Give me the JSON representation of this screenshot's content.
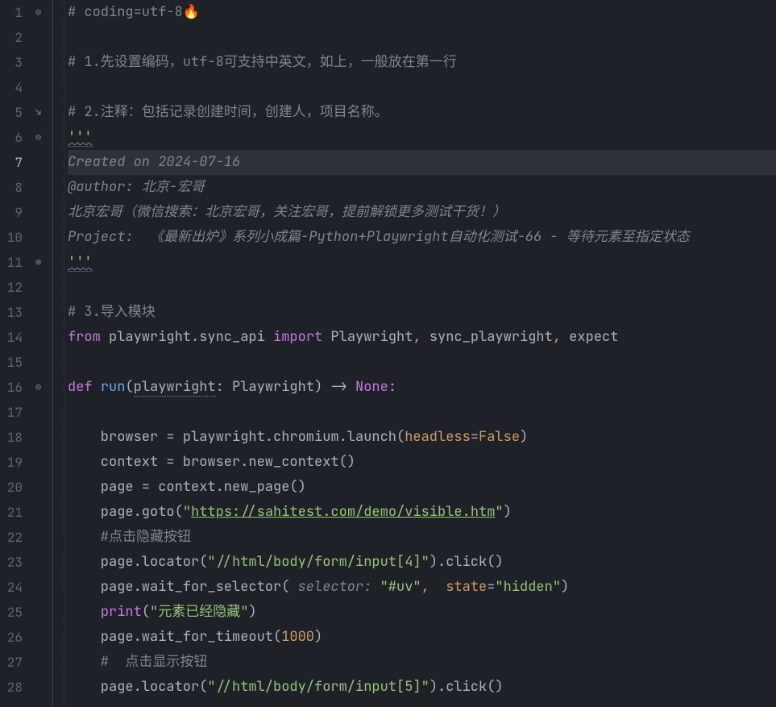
{
  "lines": {
    "count": 28,
    "current": 7
  },
  "fold_markers": [
    {
      "line": 1,
      "char": "⊖"
    },
    {
      "line": 5,
      "char": "↘"
    },
    {
      "line": 6,
      "char": "⊖"
    },
    {
      "line": 11,
      "char": "⊕"
    },
    {
      "line": 16,
      "char": "⊖"
    }
  ],
  "code": {
    "l1_a": "# coding=utf-8",
    "l1_fire": "🔥",
    "l3": "# 1.先设置编码，utf-8可支持中英文，如上，一般放在第一行",
    "l5": "# 2.注释：包括记录创建时间，创建人，项目名称。",
    "l6": "'''",
    "l7": "Created on 2024-07-16",
    "l8": "@author: 北京-宏哥",
    "l9": "北京宏哥（微信搜索：北京宏哥，关注宏哥，提前解锁更多测试干货！）",
    "l10": "Project:  《最新出炉》系列小成篇-Python+Playwright自动化测试-66 - 等待元素至指定状态",
    "l11": "'''",
    "l13": "# 3.导入模块",
    "l14_from": "from",
    "l14_mod": " playwright.sync_api ",
    "l14_import": "import",
    "l14_names": " Playwright, sync_playwright, expect",
    "l14_comma1": ",",
    "l14_comma2": ",",
    "l14_sp": " ",
    "l14_n1": " Playwright",
    "l14_n2": " sync_playwright",
    "l14_n3": " expect",
    "l16_def": "def ",
    "l16_fn": "run",
    "l16_p1": "(",
    "l16_param": "playwright",
    "l16_colon": ": ",
    "l16_type": "Playwright",
    "l16_p2": ") -> ",
    "l16_none": "None",
    "l16_end": ":",
    "l18_a": "    browser = playwright.chromium.launch(",
    "l18_hl": "headless",
    "l18_eq": "=",
    "l18_false": "False",
    "l18_p": ")",
    "l19": "    context = browser.new_context()",
    "l20": "    page = context.new_page()",
    "l21_a": "    page.goto(",
    "l21_q1": "\"",
    "l21_url": "https://sahitest.com/demo/visible.htm",
    "l21_q2": "\"",
    "l21_p": ")",
    "l22": "    #点击隐藏按钮",
    "l23_a": "    page.locator(",
    "l23_str": "\"//html/body/form/input[4]\"",
    "l23_b": ").click()",
    "l24_a": "    page.wait_for_selector(",
    "l24_hint": " selector: ",
    "l24_sel": "\"#uv\"",
    "l24_c": ",  ",
    "l24_state": "state",
    "l24_eq": "=",
    "l24_val": "\"hidden\"",
    "l24_p": ")",
    "l25_a": "    ",
    "l25_print": "print",
    "l25_p1": "(",
    "l25_str": "\"元素已经隐藏\"",
    "l25_p2": ")",
    "l26_a": "    page.wait_for_timeout(",
    "l26_num": "1000",
    "l26_p": ")",
    "l27": "    #  点击显示按钮",
    "l28_a": "    page.locator(",
    "l28_str": "\"//html/body/form/input[5]\"",
    "l28_b": ").click()"
  }
}
